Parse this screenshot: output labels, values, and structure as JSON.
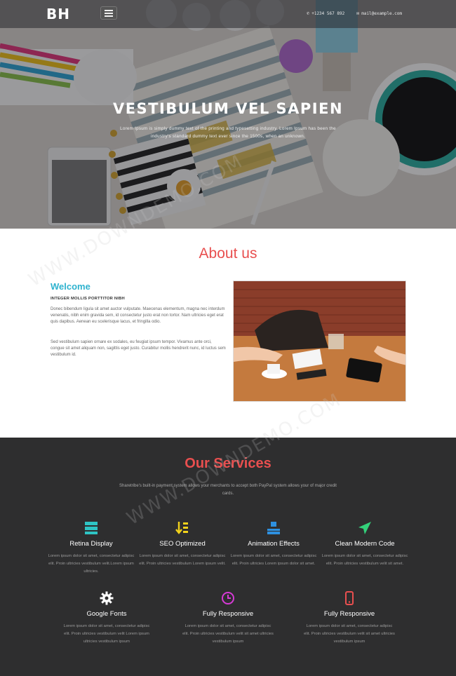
{
  "header": {
    "logo": "BH",
    "phone": "+1234 567 892",
    "email": "mail@example.com"
  },
  "hero": {
    "title": "VESTIBULUM VEL SAPIEN",
    "text": "Lorem Ipsum is simply dummy text of the printing and typesetting industry. Lorem Ipsum has been the industry's standard dummy text ever since the 1500s, when an unknown."
  },
  "about": {
    "title": "About us",
    "welcome": "Welcome",
    "subhead": "INTEGER MOLLIS PORTTITOR NIBH",
    "p1": "Donec bibendum ligula sit amet auctor vulputate. Maecenas elementum, magna nec interdum venenatis, nibh enim gravida sem, id consectetur justo erat non tortor. Nam ultricies eget erat quis dapibus. Aenean eu scelerisque lacus, et fringilla odio.",
    "p2": "Sed vestibulum sapien ornare ex sodales, eu feugiat ipsum tempor. Vivamus ante orci, congue sit amet aliquam non, sagittis eget justo. Curabitur mollis hendrerit nunc, id luctus sem vestibulum id."
  },
  "services": {
    "title": "Our Services",
    "intro": "Sharetribe's built-in payment system allows your merchants to accept both PayPal system allows your of major credit cards.",
    "items": [
      {
        "label": "Retina Display",
        "text": "Lorem ipsum dolor sit amet, consectetur adipisc elit. Proin ultricies vestibulum velit.Lorem ipsum ultricies.",
        "icon": "server-icon",
        "color": "#2ec4c4"
      },
      {
        "label": "SEO Optimized",
        "text": "Lorem ipsum dolor sit amet, consectetur adipisc elit. Proin ultricies vestibulum Lorem ipsum velit.",
        "icon": "sort-arrows-icon",
        "color": "#f2d21b"
      },
      {
        "label": "Animation Effects",
        "text": "Lorem ipsum dolor sit amet, consectetur adipisc elit. Proin ultricies Lorem ipsum dolor sit amet.",
        "icon": "sitemap-icon",
        "color": "#2e90e0"
      },
      {
        "label": "Clean Modern Code",
        "text": "Lorem ipsum dolor sit amet, consectetur adipisc elit. Proin ultricies vestibulum velit sit amet.",
        "icon": "paper-plane-icon",
        "color": "#33d17a"
      },
      {
        "label": "Google Fonts",
        "text": "Lorem ipsum dolor sit amet, consectetur adipisc elit. Proin ultricies vestibulum velit Lorem ipsum ultricies vestibulum ipsum",
        "icon": "gear-icon",
        "color": "#ffffff"
      },
      {
        "label": "Fully Responsive",
        "text": "Lorem ipsum dolor sit amet, consectetur adipisc elit. Proin ultricies vestibulum velit sit amet ultricies vestibulum ipsum",
        "icon": "clock-icon",
        "color": "#d63ad6"
      },
      {
        "label": "Fully Responsive",
        "text": "Lorem ipsum dolor sit amet, consectetur adipisc elit. Proin ultricies vestibulum velit sit amet ultricies vestibulum ipsum",
        "icon": "mobile-icon",
        "color": "#e84f4f"
      }
    ]
  },
  "colors": {
    "accent": "#e84f4f",
    "welcome": "#2fb3cf",
    "dark": "#2e2e2f"
  }
}
